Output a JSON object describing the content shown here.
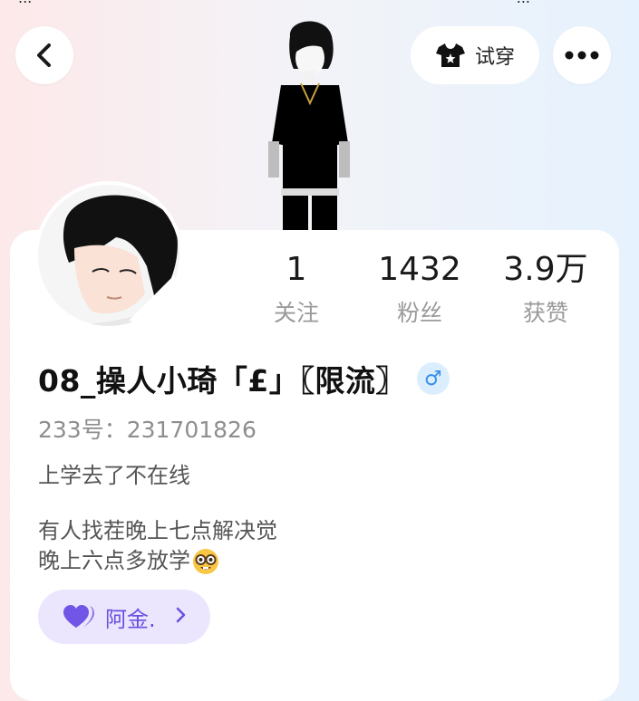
{
  "status_bar": {
    "time": "...",
    "signal": "..."
  },
  "header": {
    "back_icon": "chevron-left-icon",
    "try_on_label": "试穿",
    "try_on_icon": "tshirt-icon",
    "more_icon": "more-dots-icon"
  },
  "profile": {
    "nickname": "08_操人小琦「£」〖限流〗",
    "gender_symbol": "♂",
    "uid_label": "233号：",
    "uid": "231701826",
    "status": "上学去了不在线",
    "bio_line1": "有人找茬晚上七点解决觉",
    "bio_line2": "晚上六点多放学"
  },
  "stats": [
    {
      "value": "1",
      "label": "关注"
    },
    {
      "value": "1432",
      "label": "粉丝"
    },
    {
      "value": "3.9万",
      "label": "获赞"
    }
  ],
  "bond": {
    "label": "阿金.",
    "icon": "heart-icon"
  },
  "colors": {
    "accent_purple": "#6a4fe0",
    "pill_bg": "#ebe6fd",
    "gender_blue": "#3a8de8"
  }
}
